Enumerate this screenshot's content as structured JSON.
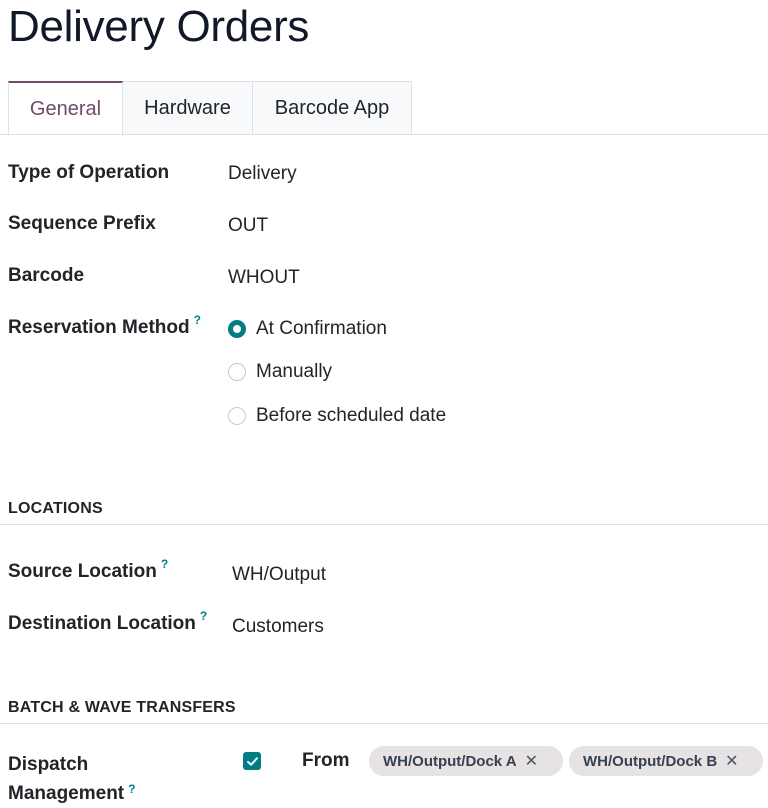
{
  "page": {
    "title": "Delivery Orders"
  },
  "tabs": [
    {
      "label": "General",
      "active": true
    },
    {
      "label": "Hardware",
      "active": false
    },
    {
      "label": "Barcode App",
      "active": false
    }
  ],
  "general": {
    "type_of_operation": {
      "label": "Type of Operation",
      "value": "Delivery"
    },
    "sequence_prefix": {
      "label": "Sequence Prefix",
      "value": "OUT"
    },
    "barcode": {
      "label": "Barcode",
      "value": "WHOUT"
    },
    "reservation_method": {
      "label": "Reservation Method",
      "help": "?",
      "options": [
        {
          "label": "At Confirmation",
          "selected": true
        },
        {
          "label": "Manually",
          "selected": false
        },
        {
          "label": "Before scheduled date",
          "selected": false
        }
      ]
    }
  },
  "locations": {
    "section_title": "LOCATIONS",
    "source": {
      "label": "Source Location",
      "help": "?",
      "value": "WH/Output"
    },
    "destination": {
      "label": "Destination Location",
      "help": "?",
      "value": "Customers"
    }
  },
  "batch": {
    "section_title": "BATCH & WAVE TRANSFERS",
    "dispatch_label_line1": "Dispatch",
    "dispatch_label_line2": "Management",
    "help": "?",
    "checked": true,
    "from_label": "From",
    "tags": [
      "WH/Output/Dock A",
      "WH/Output/Dock B"
    ],
    "tag_remove_glyph": "✕"
  },
  "colors": {
    "accent_purple": "#714b67",
    "accent_teal": "#017e84",
    "tag_bg": "#e7e3e5"
  }
}
